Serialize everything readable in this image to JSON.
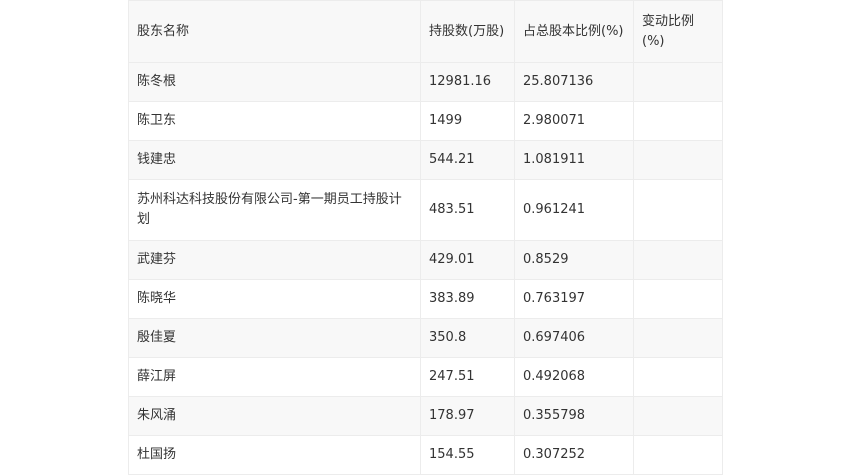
{
  "table": {
    "headers": [
      "股东名称",
      "持股数(万股)",
      "占总股本比例(%)",
      "变动比例(%)"
    ],
    "rows": [
      [
        "陈冬根",
        "12981.16",
        "25.807136",
        ""
      ],
      [
        "陈卫东",
        "1499",
        "2.980071",
        ""
      ],
      [
        "钱建忠",
        "544.21",
        "1.081911",
        ""
      ],
      [
        "苏州科达科技股份有限公司-第一期员工持股计划",
        "483.51",
        "0.961241",
        ""
      ],
      [
        "武建芬",
        "429.01",
        "0.8529",
        ""
      ],
      [
        "陈晓华",
        "383.89",
        "0.763197",
        ""
      ],
      [
        "殷佳夏",
        "350.8",
        "0.697406",
        ""
      ],
      [
        "薛江屏",
        "247.51",
        "0.492068",
        ""
      ],
      [
        "朱风涌",
        "178.97",
        "0.355798",
        ""
      ],
      [
        "杜国扬",
        "154.55",
        "0.307252",
        ""
      ]
    ]
  }
}
